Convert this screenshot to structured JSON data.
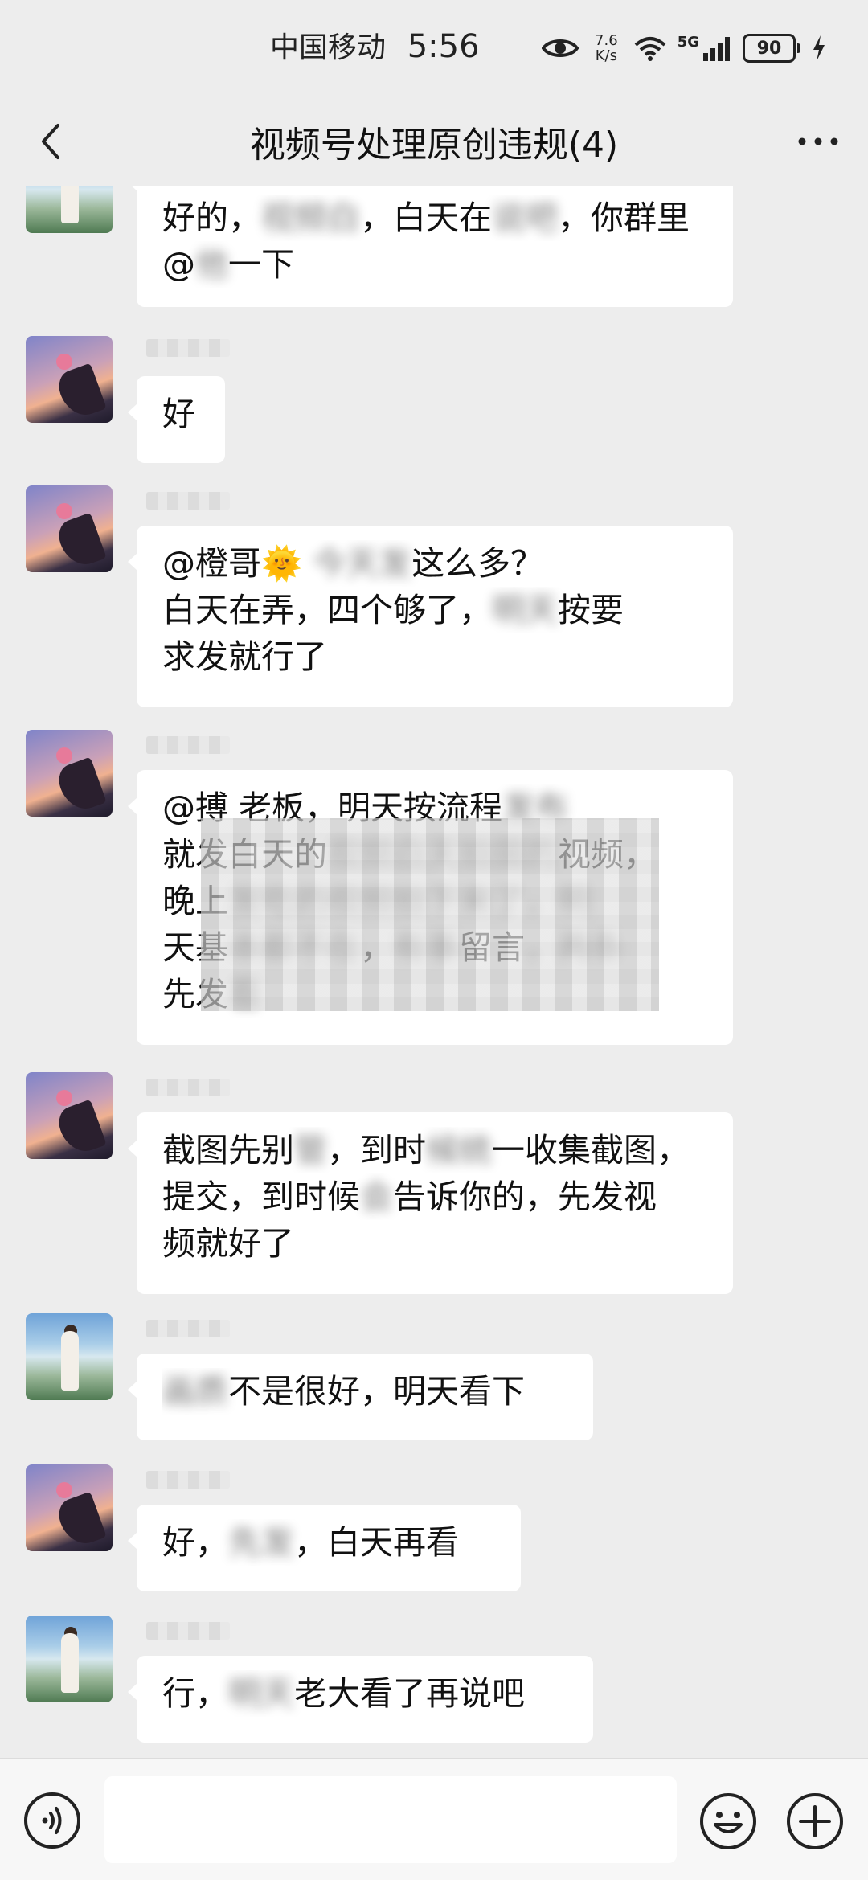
{
  "status_bar": {
    "carrier": "中国移动",
    "time": "5:56",
    "speed_value": "7.6",
    "speed_unit": "K/s",
    "network": "5G",
    "battery": "90"
  },
  "header": {
    "title": "视频号处理原创违规(4)"
  },
  "messages": [
    {
      "avatar": "beach",
      "lines": [
        "好的，<blur>，白天在<blur>，你群里",
        "@<blur>一下"
      ]
    },
    {
      "avatar": "rose",
      "lines": [
        "好"
      ]
    },
    {
      "avatar": "rose",
      "lines": [
        "@橙哥🌞 <blur>这么多？",
        "白天在弄，四个够了，<blur>按要",
        "求发就行了"
      ]
    },
    {
      "avatar": "rose",
      "lines": [
        "@搏 老板，明天按流程<blur>",
        "就发白天的<blur>视频，",
        "晚上<blur>",
        "天基<blur>，<blur>留言<blur>",
        "先发<blur>"
      ]
    },
    {
      "avatar": "rose",
      "lines": [
        "截图先别<blur>，到时<blur>一收集截图，",
        "提交，到时候<blur>告诉你的，先发视",
        "频就好了"
      ]
    },
    {
      "avatar": "beach",
      "lines": [
        "<blur>不是很好，明天看下"
      ]
    },
    {
      "avatar": "rose",
      "lines": [
        "好，<blur>，白天再看"
      ]
    },
    {
      "avatar": "beach",
      "lines": [
        "行，<blur>老大看了再说吧"
      ]
    }
  ],
  "message_text": {
    "m0": {
      "l1a": "好的，",
      "l1b": "白天在",
      "l1c": "你群里",
      "l2a": "@",
      "l2b": "一下"
    },
    "m1": {
      "l1": "好"
    },
    "m2": {
      "l1a": "@橙哥🌞",
      "l1b": "这么多？",
      "l2a": "白天在弄，四个够了，",
      "l2b": "按要",
      "l3": "求发就行了"
    },
    "m3": {
      "l1a": "@搏  老板，明天按流程",
      "l2a": "就发白天的",
      "l2b": "视频，",
      "l3a": "晚上",
      "l4a": "天基",
      "l4b": "留言",
      "l5a": "先发"
    },
    "m4": {
      "l1a": "截图先别",
      "l1b": "到时",
      "l1c": "一收集截图，",
      "l2a": "提交，到时候",
      "l2b": "告诉你的，先发视",
      "l3": "频就好了"
    },
    "m5": {
      "l1b": "不是很好，明天看下"
    },
    "m6": {
      "l1a": "好，",
      "l1b": "白天再看"
    },
    "m7": {
      "l1a": "行，",
      "l1b": "老大看了再说吧"
    }
  },
  "input": {
    "placeholder": ""
  },
  "colors": {
    "background": "#ededed",
    "bubble": "#ffffff",
    "input_bar": "#f7f7f7"
  },
  "icons": {
    "back": "chevron-left-icon",
    "more": "more-dots-icon",
    "voice": "voice-icon",
    "emoji": "emoji-icon",
    "plus": "plus-icon"
  }
}
